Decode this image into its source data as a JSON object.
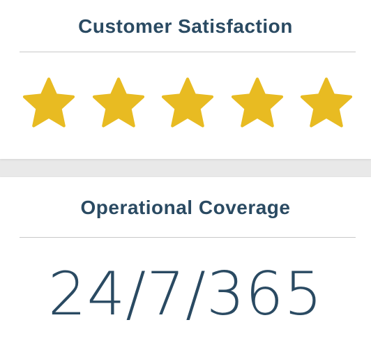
{
  "colors": {
    "heading": "#2a4a62",
    "star": "#e8bb22",
    "divider": "#c8c8c8",
    "card_background": "#ffffff",
    "page_background": "#e9e9e9"
  },
  "satisfaction_card": {
    "title": "Customer Satisfaction",
    "rating": {
      "value": 5,
      "max": 5,
      "icon": "star-icon"
    }
  },
  "coverage_card": {
    "title": "Operational Coverage",
    "value": "24/7/365"
  }
}
